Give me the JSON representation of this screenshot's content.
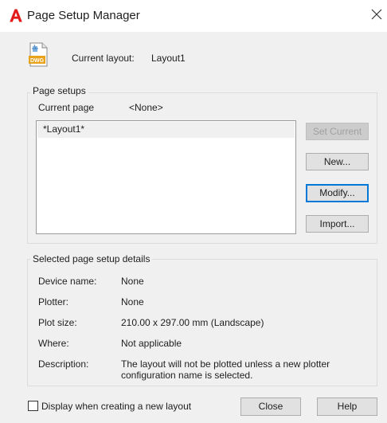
{
  "window": {
    "title": "Page Setup Manager"
  },
  "header": {
    "current_layout_label": "Current layout:",
    "current_layout_value": "Layout1"
  },
  "page_setups": {
    "legend": "Page setups",
    "current_page_label": "Current page",
    "current_page_value": "<None>",
    "items": [
      {
        "label": "*Layout1*"
      }
    ],
    "buttons": {
      "set_current": "Set Current",
      "new": "New...",
      "modify": "Modify...",
      "import": "Import..."
    }
  },
  "details": {
    "legend": "Selected page setup details",
    "device_name_label": "Device name:",
    "device_name_value": "None",
    "plotter_label": "Plotter:",
    "plotter_value": "None",
    "plot_size_label": "Plot size:",
    "plot_size_value": "210.00 x 297.00 mm (Landscape)",
    "where_label": "Where:",
    "where_value": "Not applicable",
    "description_label": "Description:",
    "description_line1": "The layout will not be plotted unless a new plotter",
    "description_line2": "configuration name is selected."
  },
  "footer": {
    "display_checkbox_label": "Display when creating a new layout",
    "display_checked": false,
    "close_label": "Close",
    "help_label": "Help"
  },
  "icons": {
    "app": "autocad-logo-icon",
    "file": "dwg-file-icon",
    "close": "close-icon"
  },
  "colors": {
    "brand_red": "#e21b1b",
    "focus_blue": "#0078d7",
    "dialog_bg": "#f0f0f0"
  }
}
